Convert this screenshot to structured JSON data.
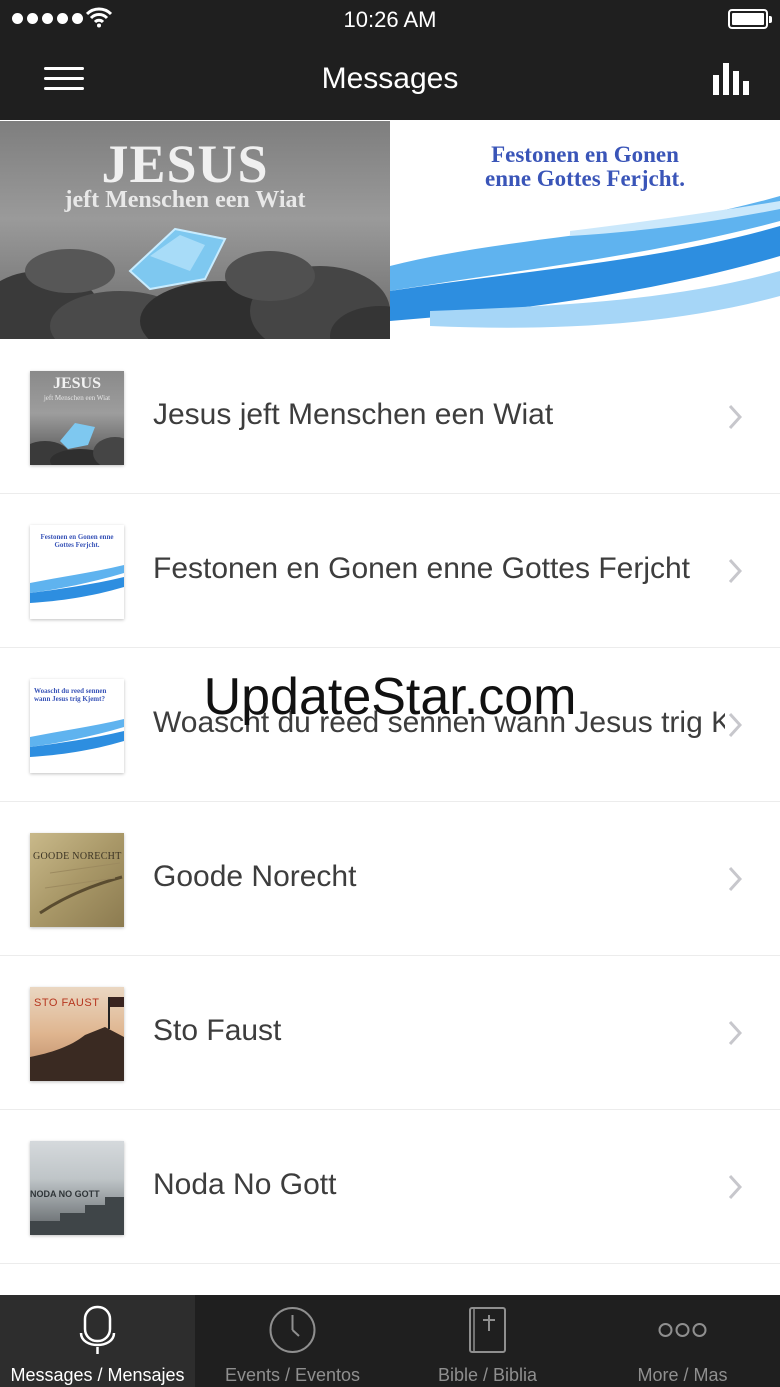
{
  "status_bar": {
    "time": "10:26 AM"
  },
  "navbar": {
    "title": "Messages"
  },
  "banner": {
    "left_title": "JESUS",
    "left_subtitle": "jeft Menschen een Wiat",
    "right_line1": "Festonen en Gonen",
    "right_line2": "enne Gottes Ferjcht."
  },
  "messages": [
    {
      "title": "Jesus jeft Menschen een Wiat",
      "thumb_title": "JESUS",
      "thumb_subtitle": "jeft Menschen een Wiat"
    },
    {
      "title": "Festonen en Gonen enne Gottes Ferjcht",
      "thumb_title": "Festonen en Gonen enne Gottes Ferjcht."
    },
    {
      "title": "Woascht du reed sennen wann Jesus trig Kjemt?",
      "thumb_title": "Woascht du reed sennen wann Jesus trig Kjemt?"
    },
    {
      "title": "Goode Norecht",
      "thumb_title": "GOODE NORECHT"
    },
    {
      "title": "Sto Faust",
      "thumb_title": "STO FAUST"
    },
    {
      "title": "Noda No Gott",
      "thumb_title": "NODA NO GOTT"
    }
  ],
  "watermark": "UpdateStar.com",
  "tabs": [
    {
      "label": "Messages / Mensajes",
      "icon": "microphone-icon",
      "active": true
    },
    {
      "label": "Events / Eventos",
      "icon": "clock-icon",
      "active": false
    },
    {
      "label": "Bible / Biblia",
      "icon": "bible-icon",
      "active": false
    },
    {
      "label": "More / Mas",
      "icon": "more-dots-icon",
      "active": false
    }
  ],
  "colors": {
    "bars": "#1f1f1f",
    "active_tab": "#2d2d2d",
    "text": "#3d3d3d",
    "accent_blue": "#3a55b8"
  }
}
